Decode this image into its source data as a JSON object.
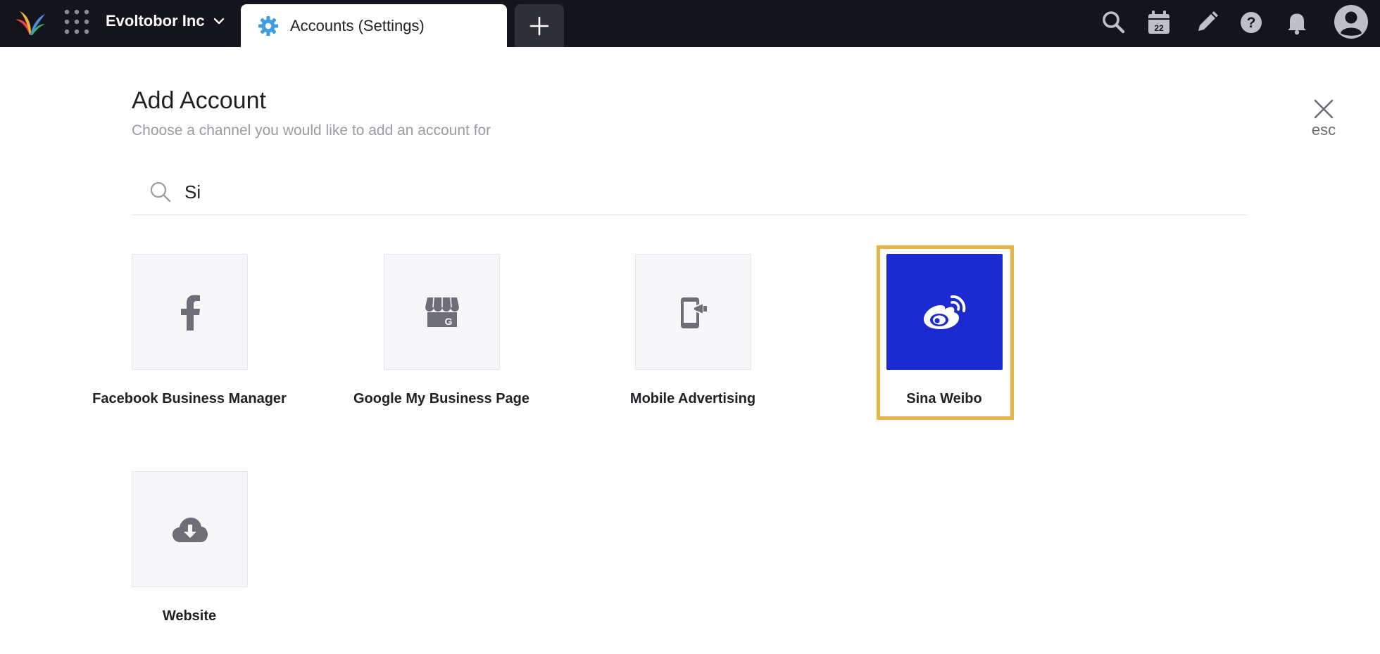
{
  "topbar": {
    "org_name": "Evoltobor Inc",
    "tab_label": "Accounts (Settings)",
    "icons": [
      "logo",
      "apps-grid-icon",
      "chevron-down-icon",
      "gear-icon",
      "plus-icon",
      "search-icon",
      "calendar-icon",
      "pencil-icon",
      "help-icon",
      "bell-icon",
      "avatar-icon"
    ],
    "calendar_day": "22"
  },
  "page": {
    "title": "Add Account",
    "subtitle": "Choose a channel you would like to add an account for",
    "close_hint": "esc"
  },
  "search": {
    "value": "Si",
    "placeholder": ""
  },
  "channels": [
    {
      "label": "Facebook Business Manager",
      "icon": "facebook-icon",
      "selected": false
    },
    {
      "label": "Google My Business Page",
      "icon": "google-my-business-icon",
      "selected": false
    },
    {
      "label": "Mobile Advertising",
      "icon": "mobile-advertising-icon",
      "selected": false
    },
    {
      "label": "Sina Weibo",
      "icon": "weibo-icon",
      "selected": true
    },
    {
      "label": "Website",
      "icon": "cloud-download-icon",
      "selected": false
    }
  ],
  "colors": {
    "topbar_bg": "#13141c",
    "selected_tile": "#1b2ad1",
    "highlight_border": "#e9b447",
    "tile_bg": "#f7f7fa",
    "icon_gray": "#6d6e78"
  }
}
